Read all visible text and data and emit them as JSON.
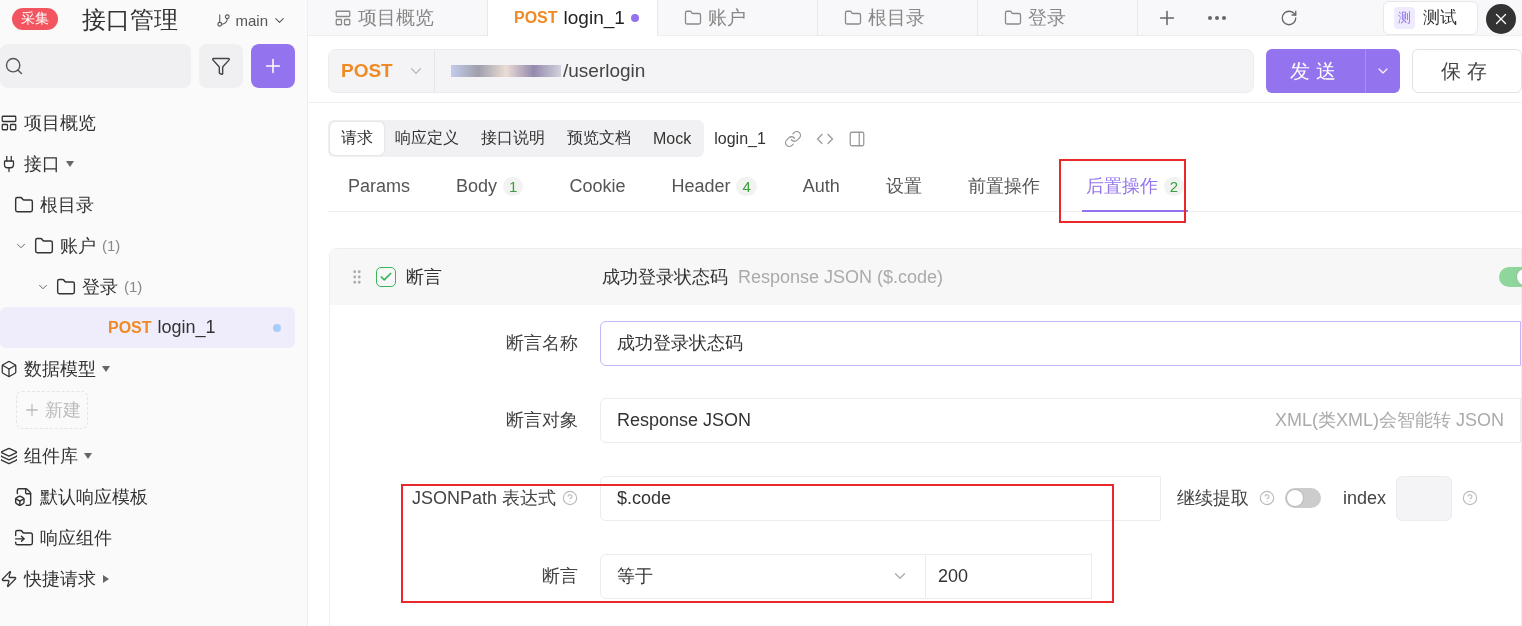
{
  "sidebar": {
    "title": "接口管理",
    "branch": "main",
    "badge": "采集",
    "items": [
      {
        "kind": "overview",
        "label": "项目概览"
      },
      {
        "kind": "section",
        "label": "接口",
        "expanded": true,
        "children": [
          {
            "kind": "folder",
            "label": "根目录"
          },
          {
            "kind": "folder",
            "label": "账户",
            "count": "(1)",
            "expanded": true,
            "children": [
              {
                "kind": "folder",
                "label": "登录",
                "count": "(1)",
                "expanded": true,
                "children": [
                  {
                    "kind": "request",
                    "method": "POST",
                    "label": "login_1",
                    "selected": true,
                    "unsaved": true
                  }
                ]
              }
            ]
          }
        ]
      },
      {
        "kind": "section",
        "label": "数据模型",
        "expanded": true,
        "children": [
          {
            "kind": "new",
            "label": "新建"
          }
        ]
      },
      {
        "kind": "section",
        "label": "组件库",
        "expanded": true,
        "children": [
          {
            "kind": "template",
            "label": "默认响应模板"
          },
          {
            "kind": "component",
            "label": "响应组件"
          }
        ]
      },
      {
        "kind": "section",
        "label": "快捷请求",
        "expanded": false
      }
    ]
  },
  "tabs": [
    {
      "kind": "overview",
      "label": "项目概览",
      "selected": false
    },
    {
      "kind": "request",
      "method": "POST",
      "label": "login_1",
      "selected": true,
      "unsaved": true
    },
    {
      "kind": "folder",
      "label": "账户",
      "selected": false
    },
    {
      "kind": "folder",
      "label": "根目录",
      "selected": false
    },
    {
      "kind": "folder",
      "label": "登录",
      "selected": false
    }
  ],
  "environment": {
    "icon": "测",
    "label": "测试"
  },
  "request": {
    "method": "POST",
    "url": "/userlogin",
    "send": "发送",
    "save": "保存"
  },
  "doc_tabs": [
    {
      "label": "请求",
      "selected": true
    },
    {
      "label": "响应定义",
      "selected": false
    },
    {
      "label": "接口说明",
      "selected": false
    },
    {
      "label": "预览文档",
      "selected": false
    },
    {
      "label": "Mock",
      "selected": false
    }
  ],
  "doc_name": "login_1",
  "param_tabs": [
    {
      "label": "Params",
      "selected": false
    },
    {
      "label": "Body",
      "count": "1",
      "selected": false
    },
    {
      "label": "Cookie",
      "selected": false
    },
    {
      "label": "Header",
      "count": "4",
      "selected": false
    },
    {
      "label": "Auth",
      "selected": false
    },
    {
      "label": "设置",
      "selected": false
    },
    {
      "label": "前置操作",
      "selected": false
    },
    {
      "label": "后置操作",
      "count": "2",
      "selected": true
    }
  ],
  "assertion": {
    "type": "断言",
    "enabled": true,
    "checked": true,
    "name": "成功登录状态码",
    "summary": "Response JSON ($.code)",
    "fields": [
      {
        "kind": "input",
        "label": "断言名称",
        "value": "成功登录状态码",
        "focused": true
      },
      {
        "kind": "select",
        "label": "断言对象",
        "value": "Response JSON",
        "hint": "XML(类XML)会智能转 JSON"
      },
      {
        "kind": "jsonpath",
        "label": "JSONPath 表达式",
        "value": "$.code",
        "extract_label": "继续提取",
        "extract": false,
        "index_label": "index"
      },
      {
        "kind": "compare",
        "label": "断言",
        "operator": "等于",
        "value": "200"
      }
    ]
  }
}
